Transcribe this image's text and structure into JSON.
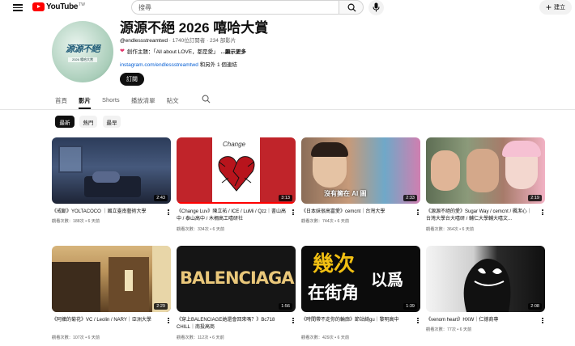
{
  "topbar": {
    "logo_text": "YouTube",
    "logo_tm": "TW",
    "search_placeholder": "搜尋",
    "create_label": "建立"
  },
  "channel": {
    "avatar_title": "源源不絕",
    "avatar_sub": "2026 嘻哈大賞",
    "title": "源源不絕 2026 嘻哈大賞",
    "handle": "@endlessstreamtwd",
    "subscribers": "1740位訂閱者",
    "video_count": "234 部影片",
    "description": "創作主題：「All about LOVE，都是愛」",
    "more_label": "...顯示更多",
    "link_url": "instagram.com/endlessstreamtwd",
    "link_more": "和另外 1 個連結",
    "subscribe_label": "訂閱"
  },
  "tabs": [
    {
      "label": "首頁",
      "active": false
    },
    {
      "label": "影片",
      "active": true
    },
    {
      "label": "Shorts",
      "active": false
    },
    {
      "label": "播放清單",
      "active": false
    },
    {
      "label": "貼文",
      "active": false
    }
  ],
  "chips": [
    {
      "label": "最新",
      "active": true
    },
    {
      "label": "熱門",
      "active": false
    },
    {
      "label": "最早",
      "active": false
    }
  ],
  "videos": [
    {
      "title": "《戒斷》YOLTACOCO ｜國立臺南藝術大學",
      "meta": "觀看次數：188次 • 6 天前",
      "duration": "2:43",
      "progress": 0
    },
    {
      "title": "《Change Luv》陳立祐 / ICE / LuMi / Qzz｜書山高中 / 泰山高中 / 木柵高工嘻研社",
      "meta": "觀看次數：334次 • 6 天前",
      "duration": "3:13",
      "progress": 1.0
    },
    {
      "title": "《日本妹很高富愛》cemcnt｜台灣大學",
      "meta": "觀看次數：744次 • 6 天前",
      "duration": "2:33",
      "progress": 0
    },
    {
      "title": "《源源不絕的愛》Sugar Way / cemcnt / 楓潔心｜台灣大學台大嘻研 / 輔仁大學輔大嘻文...",
      "meta": "觀看次數：364次 • 6 天前",
      "duration": "2:19",
      "progress": 0
    },
    {
      "title": "《阿嬤的菊花》VC / Leolin / NARY｜亞洲大學",
      "meta": "觀看次數：107次 • 6 天前",
      "duration": "2:29",
      "progress": 0
    },
    {
      "title": "《穿上BALENCIAGE她還會回來嗎？》Bc718 CHILL｜南投高商",
      "meta": "觀看次數：112次 • 6 天前",
      "duration": "1:56",
      "progress": 0
    },
    {
      "title": "《時間帶不走你的輪廓》節站綺gu｜黎明高中",
      "meta": "觀看次數：429次 • 6 天前",
      "duration": "1:39",
      "progress": 0
    },
    {
      "title": "《venom heart》HXW｜仁德商專",
      "meta": "觀看次數：77次 • 6 天前",
      "duration": "2:08",
      "progress": 0
    }
  ],
  "thumb_text": {
    "v2": "Change",
    "v3": "沒有擁在 AI 圖",
    "v6": "BALENCIAGA",
    "v7a": "幾次",
    "v7b": "在街角",
    "v7c": "以爲"
  }
}
